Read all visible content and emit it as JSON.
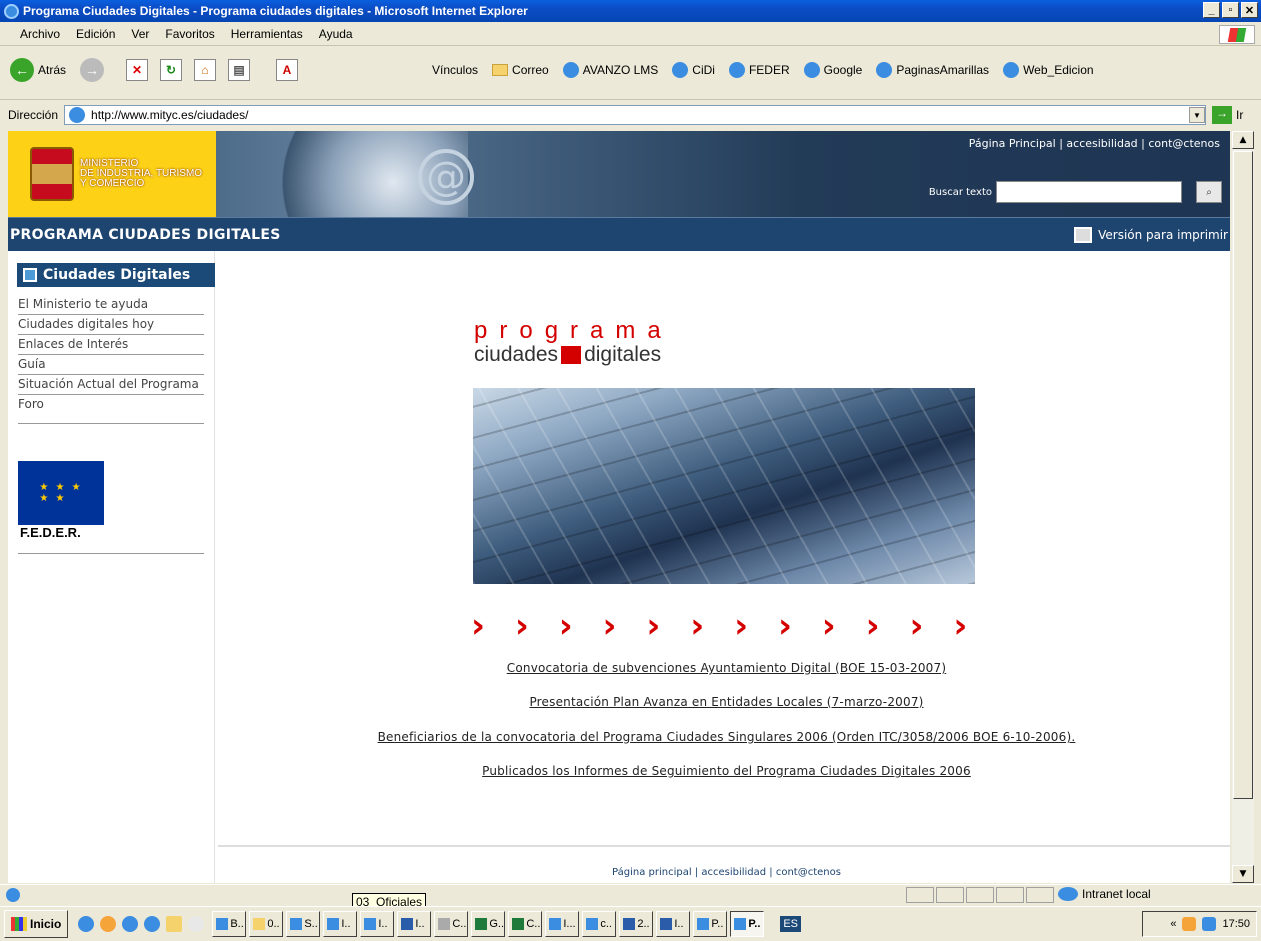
{
  "window": {
    "title": "Programa Ciudades Digitales - Programa ciudades digitales - Microsoft Internet Explorer",
    "btn_min": "_",
    "btn_max": "▫",
    "btn_close": "✕"
  },
  "menu": [
    "Archivo",
    "Edición",
    "Ver",
    "Favoritos",
    "Herramientas",
    "Ayuda"
  ],
  "toolbar": {
    "back": "Atrás",
    "links_label": "Vínculos",
    "links": [
      "Correo",
      "AVANZO LMS",
      "CiDi",
      "FEDER",
      "Google",
      "PaginasAmarillas",
      "Web_Edicion"
    ]
  },
  "address": {
    "label": "Dirección",
    "url": "http://www.mityc.es/ciudades/",
    "go": "Ir"
  },
  "banner": {
    "ministry_line1": "MINISTERIO",
    "ministry_line2": "DE INDUSTRIA, TURISMO",
    "ministry_line3": "Y COMERCIO",
    "top_links": "Página Principal | accesibilidad | cont@ctenos",
    "search_label": "Buscar texto",
    "search_value": ""
  },
  "header": {
    "title": "PROGRAMA CIUDADES DIGITALES",
    "print": "Versión para imprimir"
  },
  "sidebar": {
    "title": "Ciudades Digitales",
    "items": [
      "El Ministerio te ayuda",
      "Ciudades digitales hoy",
      "Enlaces de Interés",
      "Guía",
      "Situación Actual del Programa",
      "Foro"
    ],
    "feder": "F.E.D.E.R."
  },
  "logo": {
    "line1": "programa",
    "line2a": "ciudades",
    "line2b": "digitales"
  },
  "chevrons": "› › › › › › › › › › › ›",
  "news": [
    "Convocatoria de subvenciones Ayuntamiento Digital (BOE 15-03-2007)",
    "Presentación Plan Avanza en Entidades Locales (7-marzo-2007)",
    "Beneficiarios de la convocatoria del Programa Ciudades Singulares 2006 (Orden ITC/3058/2006 BOE 6-10-2006).",
    "Publicados los Informes de Seguimiento del Programa Ciudades Digitales 2006"
  ],
  "footer": "Página principal | accesibilidad | cont@ctenos",
  "status": {
    "zone": "Intranet local",
    "tooltip": "03_Oficiales"
  },
  "taskbar": {
    "start": "Inicio",
    "tasks": [
      "B..",
      "0..",
      "S..",
      "I..",
      "I..",
      "I..",
      "C..",
      "G..",
      "C..",
      "I...",
      "c..",
      "2..",
      "I..",
      "P..",
      "P.."
    ],
    "lang": "ES",
    "clock": "17:50"
  }
}
